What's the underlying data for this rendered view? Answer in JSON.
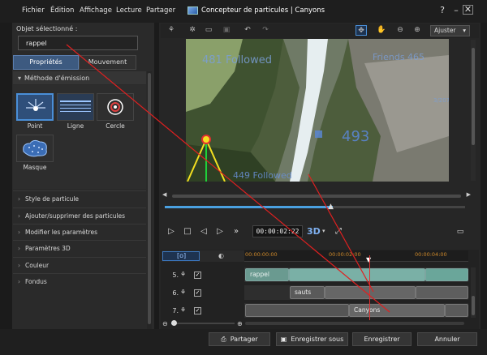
{
  "menu": {
    "fichier": "Fichier",
    "edition": "Édition",
    "affichage": "Affichage",
    "lecture": "Lecture",
    "partager": "Partager"
  },
  "title": "Concepteur de particules | Canyons",
  "window": {
    "help": "?",
    "minimize": "–",
    "maximize": "□",
    "close": "✕"
  },
  "left": {
    "obj_label": "Objet sélectionné :",
    "obj_value": "rappel",
    "tabs": [
      "Propriétés",
      "Mouvement"
    ],
    "emission_header": "Méthode d'émission",
    "emission_items": [
      "Point",
      "Ligne",
      "Cercle",
      "Masque"
    ],
    "sections": [
      "Style de particule",
      "Ajouter/supprimer des particules",
      "Modifier les paramètres",
      "Paramètres 3D",
      "Couleur",
      "Fondus"
    ]
  },
  "toolbar": {
    "fit": "Ajuster"
  },
  "video": {
    "overlay_followed": "481 Followed",
    "overlay_friends": "Friends 465",
    "overlay_small": "3/207",
    "overlay_big": "493",
    "overlay_bottom": "449 Followed"
  },
  "player": {
    "timecode": "00:00:02:22",
    "three_d": "3D"
  },
  "timeline": {
    "ticks": [
      "00:00:00:00",
      "00:00:02:00",
      "00:00:04:00"
    ],
    "rows": [
      {
        "num": "5.",
        "clips": [
          "rappel"
        ]
      },
      {
        "num": "6.",
        "clips": [
          "sauts"
        ]
      },
      {
        "num": "7.",
        "clips": [
          "Canyons"
        ]
      }
    ]
  },
  "buttons": {
    "share": "Partager",
    "save_as": "Enregistrer sous",
    "save": "Enregistrer",
    "cancel": "Annuler"
  },
  "colors": {
    "accent": "#4a8fd8",
    "clip": "#6aa69a",
    "annotation": "#e02020"
  }
}
